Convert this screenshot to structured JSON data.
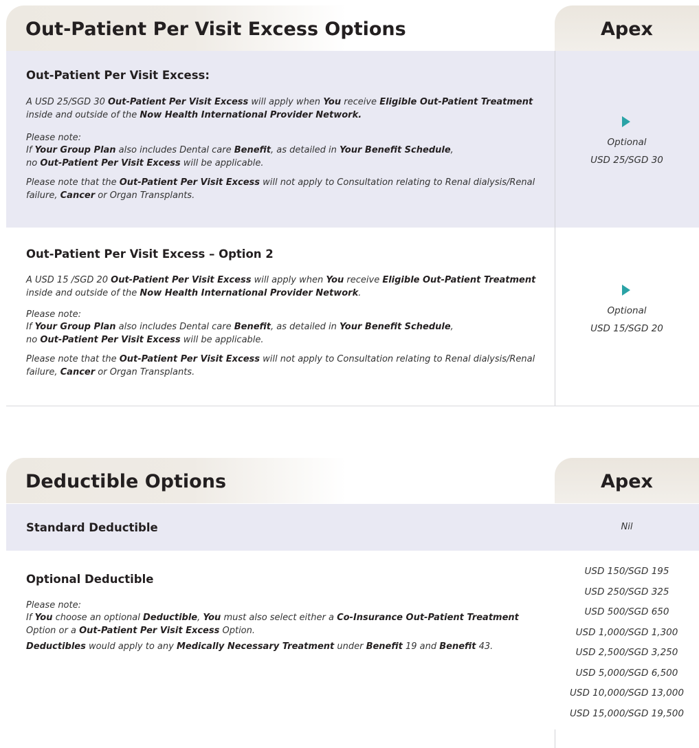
{
  "section1": {
    "title": "Out-Patient Per Visit Excess Options",
    "plan": "Apex",
    "row1": {
      "heading": "Out-Patient Per Visit Excess:",
      "p1": [
        {
          "t": "A USD 25/SGD 30 "
        },
        {
          "t": "Out-Patient Per Visit Excess",
          "b": true
        },
        {
          "t": " will apply when "
        },
        {
          "t": "You",
          "b": true
        },
        {
          "t": " receive "
        },
        {
          "t": "Eligible Out-Patient Treatment",
          "b": true
        },
        {
          "t": " inside and outside of the "
        },
        {
          "t": "Now Health International Provider Network.",
          "b": true
        }
      ],
      "p2a": "Please note:",
      "p2": [
        {
          "t": "If "
        },
        {
          "t": "Your Group Plan",
          "b": true
        },
        {
          "t": " also includes Dental care "
        },
        {
          "t": "Benefit",
          "b": true
        },
        {
          "t": ", as detailed in "
        },
        {
          "t": "Your Benefit Schedule",
          "b": true
        },
        {
          "t": ","
        },
        {
          "br": true
        },
        {
          "t": "no "
        },
        {
          "t": "Out-Patient Per Visit Excess",
          "b": true
        },
        {
          "t": " will be applicable."
        }
      ],
      "p3": [
        {
          "t": "Please note that the "
        },
        {
          "t": "Out-Patient Per Visit Excess",
          "b": true
        },
        {
          "t": " will not apply to Consultation relating to Renal dialysis/Renal failure, "
        },
        {
          "t": "Cancer",
          "b": true
        },
        {
          "t": " or Organ Transplants."
        }
      ],
      "option_label": "Optional",
      "option_value": "USD 25/SGD 30"
    },
    "row2": {
      "heading": "Out-Patient Per Visit Excess – Option 2",
      "p1": [
        {
          "t": "A USD 15 /SGD 20 "
        },
        {
          "t": "Out-Patient Per Visit Excess",
          "b": true
        },
        {
          "t": " will apply when "
        },
        {
          "t": "You",
          "b": true
        },
        {
          "t": " receive "
        },
        {
          "t": "Eligible Out-Patient Treatment",
          "b": true
        },
        {
          "t": " inside and outside of the "
        },
        {
          "t": "Now Health International Provider Network",
          "b": true
        },
        {
          "t": "."
        }
      ],
      "p2a": "Please note:",
      "p2": [
        {
          "t": "If "
        },
        {
          "t": "Your Group Plan",
          "b": true
        },
        {
          "t": " also includes Dental care "
        },
        {
          "t": "Benefit",
          "b": true
        },
        {
          "t": ", as detailed in "
        },
        {
          "t": "Your Benefit Schedule",
          "b": true
        },
        {
          "t": ","
        },
        {
          "br": true
        },
        {
          "t": "no "
        },
        {
          "t": "Out-Patient Per Visit Excess",
          "b": true
        },
        {
          "t": " will be applicable."
        }
      ],
      "p3": [
        {
          "t": "Please note that the "
        },
        {
          "t": "Out-Patient Per Visit Excess",
          "b": true
        },
        {
          "t": " will not apply to Consultation relating to Renal dialysis/Renal failure, "
        },
        {
          "t": "Cancer",
          "b": true
        },
        {
          "t": " or Organ Transplants."
        }
      ],
      "option_label": "Optional",
      "option_value": "USD 15/SGD 20"
    }
  },
  "section2": {
    "title": "Deductible Options",
    "plan": "Apex",
    "standard": {
      "heading": "Standard Deductible",
      "value": "Nil"
    },
    "optional": {
      "heading": "Optional Deductible",
      "p1a": "Please note:",
      "p1": [
        {
          "t": "If "
        },
        {
          "t": "You",
          "b": true
        },
        {
          "t": " choose an optional "
        },
        {
          "t": "Deductible",
          "b": true
        },
        {
          "t": ", "
        },
        {
          "t": "You",
          "b": true
        },
        {
          "t": " must also select either a "
        },
        {
          "t": "Co-Insurance Out-Patient Treatment",
          "b": true
        },
        {
          "t": " Option or a "
        },
        {
          "t": "Out-Patient Per Visit Excess",
          "b": true
        },
        {
          "t": " Option."
        }
      ],
      "p2": [
        {
          "t": "Deductibles",
          "b": true
        },
        {
          "t": " would apply to any "
        },
        {
          "t": "Medically Necessary Treatment",
          "b": true
        },
        {
          "t": " under "
        },
        {
          "t": "Benefit",
          "b": true
        },
        {
          "t": " 19 and "
        },
        {
          "t": "Benefit",
          "b": true
        },
        {
          "t": " 43."
        }
      ],
      "values": [
        "USD 150/SGD 195",
        "USD 250/SGD 325",
        "USD 500/SGD 650",
        "USD 1,000/SGD 1,300",
        "USD 2,500/SGD 3,250",
        "USD 5,000/SGD 6,500",
        "USD 10,000/SGD 13,000",
        "USD 15,000/SGD 19,500"
      ]
    }
  },
  "colors": {
    "shade": "#e9e9f3",
    "header": "#ede9e2",
    "play_icon": "#2aa3a6"
  }
}
